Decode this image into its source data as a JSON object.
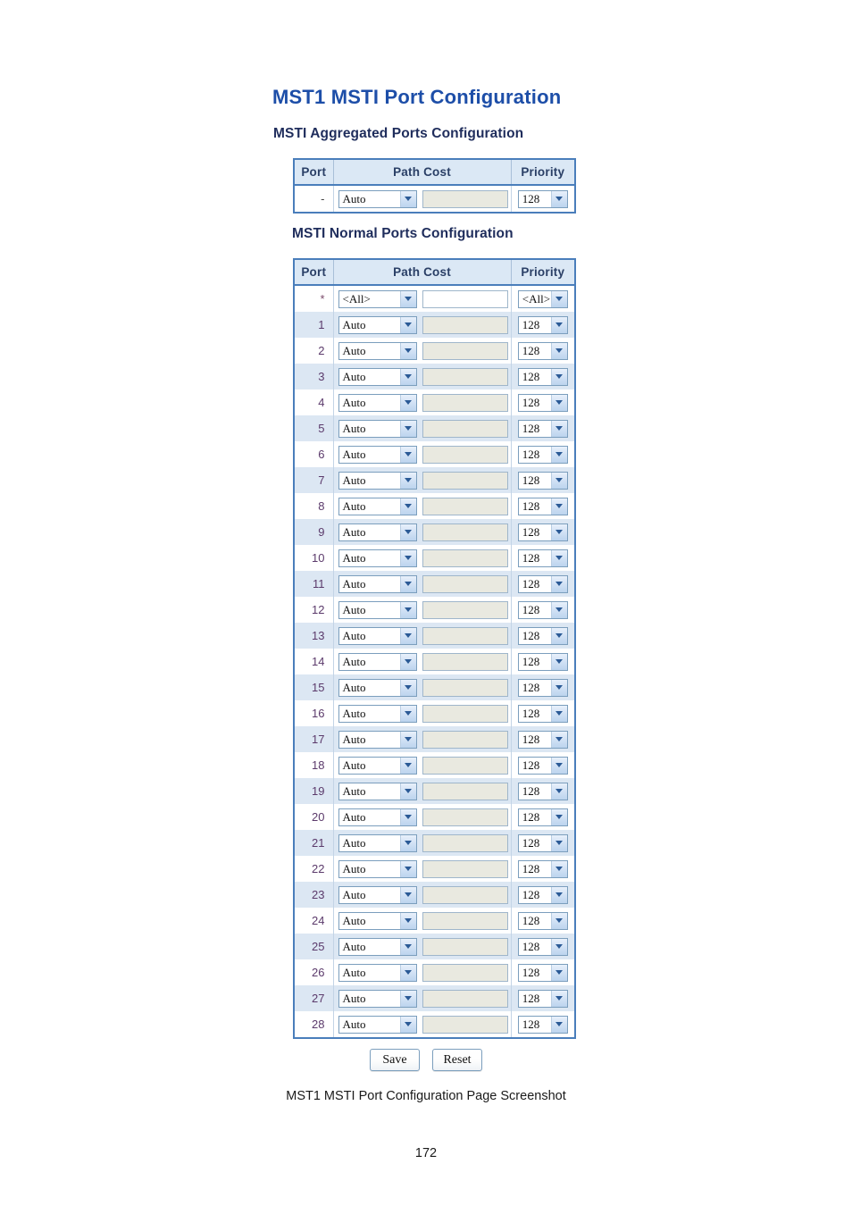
{
  "page": {
    "title": "MST1 MSTI Port Configuration",
    "caption": "MST1 MSTI Port Configuration Page Screenshot",
    "page_number": "172",
    "colors": {
      "title_blue": "#1d4ea8",
      "section_navy": "#1f2d5c",
      "table_border": "#4a7ebb",
      "header_bg": "#dbe8f5",
      "row_shade": "#dce7f3",
      "row_plain": "#ffffff",
      "disabled_input": "#e9e9e0",
      "port_number": "#5b3a6b"
    }
  },
  "aggregated": {
    "section_title": "MSTI Aggregated Ports Configuration",
    "columns": [
      "Port",
      "Path Cost",
      "Priority"
    ],
    "rows": [
      {
        "port": "-",
        "path_cost_select": "Auto",
        "path_cost_value": "",
        "path_cost_enabled": false,
        "priority": "128"
      }
    ]
  },
  "normal": {
    "section_title": "MSTI Normal Ports Configuration",
    "columns": [
      "Port",
      "Path Cost",
      "Priority"
    ],
    "rows": [
      {
        "port": "*",
        "path_cost_select": "<All>",
        "path_cost_value": "",
        "path_cost_enabled": true,
        "priority": "<All>"
      },
      {
        "port": "1",
        "path_cost_select": "Auto",
        "path_cost_value": "",
        "path_cost_enabled": false,
        "priority": "128"
      },
      {
        "port": "2",
        "path_cost_select": "Auto",
        "path_cost_value": "",
        "path_cost_enabled": false,
        "priority": "128"
      },
      {
        "port": "3",
        "path_cost_select": "Auto",
        "path_cost_value": "",
        "path_cost_enabled": false,
        "priority": "128"
      },
      {
        "port": "4",
        "path_cost_select": "Auto",
        "path_cost_value": "",
        "path_cost_enabled": false,
        "priority": "128"
      },
      {
        "port": "5",
        "path_cost_select": "Auto",
        "path_cost_value": "",
        "path_cost_enabled": false,
        "priority": "128"
      },
      {
        "port": "6",
        "path_cost_select": "Auto",
        "path_cost_value": "",
        "path_cost_enabled": false,
        "priority": "128"
      },
      {
        "port": "7",
        "path_cost_select": "Auto",
        "path_cost_value": "",
        "path_cost_enabled": false,
        "priority": "128"
      },
      {
        "port": "8",
        "path_cost_select": "Auto",
        "path_cost_value": "",
        "path_cost_enabled": false,
        "priority": "128"
      },
      {
        "port": "9",
        "path_cost_select": "Auto",
        "path_cost_value": "",
        "path_cost_enabled": false,
        "priority": "128"
      },
      {
        "port": "10",
        "path_cost_select": "Auto",
        "path_cost_value": "",
        "path_cost_enabled": false,
        "priority": "128"
      },
      {
        "port": "11",
        "path_cost_select": "Auto",
        "path_cost_value": "",
        "path_cost_enabled": false,
        "priority": "128"
      },
      {
        "port": "12",
        "path_cost_select": "Auto",
        "path_cost_value": "",
        "path_cost_enabled": false,
        "priority": "128"
      },
      {
        "port": "13",
        "path_cost_select": "Auto",
        "path_cost_value": "",
        "path_cost_enabled": false,
        "priority": "128"
      },
      {
        "port": "14",
        "path_cost_select": "Auto",
        "path_cost_value": "",
        "path_cost_enabled": false,
        "priority": "128"
      },
      {
        "port": "15",
        "path_cost_select": "Auto",
        "path_cost_value": "",
        "path_cost_enabled": false,
        "priority": "128"
      },
      {
        "port": "16",
        "path_cost_select": "Auto",
        "path_cost_value": "",
        "path_cost_enabled": false,
        "priority": "128"
      },
      {
        "port": "17",
        "path_cost_select": "Auto",
        "path_cost_value": "",
        "path_cost_enabled": false,
        "priority": "128"
      },
      {
        "port": "18",
        "path_cost_select": "Auto",
        "path_cost_value": "",
        "path_cost_enabled": false,
        "priority": "128"
      },
      {
        "port": "19",
        "path_cost_select": "Auto",
        "path_cost_value": "",
        "path_cost_enabled": false,
        "priority": "128"
      },
      {
        "port": "20",
        "path_cost_select": "Auto",
        "path_cost_value": "",
        "path_cost_enabled": false,
        "priority": "128"
      },
      {
        "port": "21",
        "path_cost_select": "Auto",
        "path_cost_value": "",
        "path_cost_enabled": false,
        "priority": "128"
      },
      {
        "port": "22",
        "path_cost_select": "Auto",
        "path_cost_value": "",
        "path_cost_enabled": false,
        "priority": "128"
      },
      {
        "port": "23",
        "path_cost_select": "Auto",
        "path_cost_value": "",
        "path_cost_enabled": false,
        "priority": "128"
      },
      {
        "port": "24",
        "path_cost_select": "Auto",
        "path_cost_value": "",
        "path_cost_enabled": false,
        "priority": "128"
      },
      {
        "port": "25",
        "path_cost_select": "Auto",
        "path_cost_value": "",
        "path_cost_enabled": false,
        "priority": "128"
      },
      {
        "port": "26",
        "path_cost_select": "Auto",
        "path_cost_value": "",
        "path_cost_enabled": false,
        "priority": "128"
      },
      {
        "port": "27",
        "path_cost_select": "Auto",
        "path_cost_value": "",
        "path_cost_enabled": false,
        "priority": "128"
      },
      {
        "port": "28",
        "path_cost_select": "Auto",
        "path_cost_value": "",
        "path_cost_enabled": false,
        "priority": "128"
      }
    ]
  },
  "actions": {
    "save_label": "Save",
    "reset_label": "Reset"
  }
}
